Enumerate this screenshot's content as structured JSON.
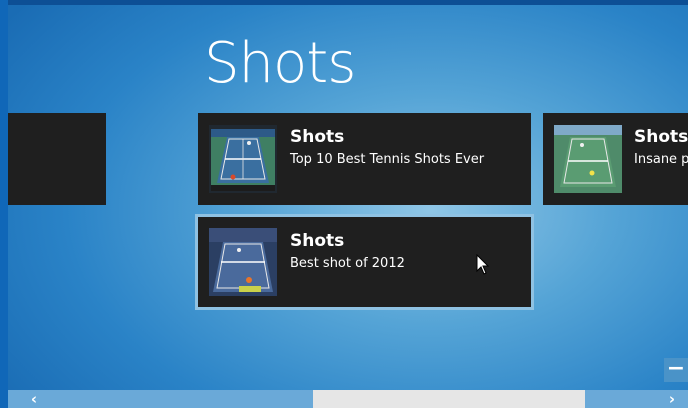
{
  "page": {
    "title": "Shots"
  },
  "tiles": [
    {
      "name": "Shots",
      "description": "Top 10 Best Tennis Shots Ever"
    },
    {
      "name": "Shots",
      "description": "Insane p"
    },
    {
      "name": "Shots",
      "description": "Best shot of 2012"
    }
  ],
  "thumbnails": [
    {
      "alt": "tennis-court-thumbnail-1"
    },
    {
      "alt": "tennis-court-thumbnail-2"
    },
    {
      "alt": "tennis-court-thumbnail-3"
    }
  ],
  "controls": {
    "zoom_label": "−",
    "scroll_left": "‹",
    "scroll_right": "›"
  }
}
